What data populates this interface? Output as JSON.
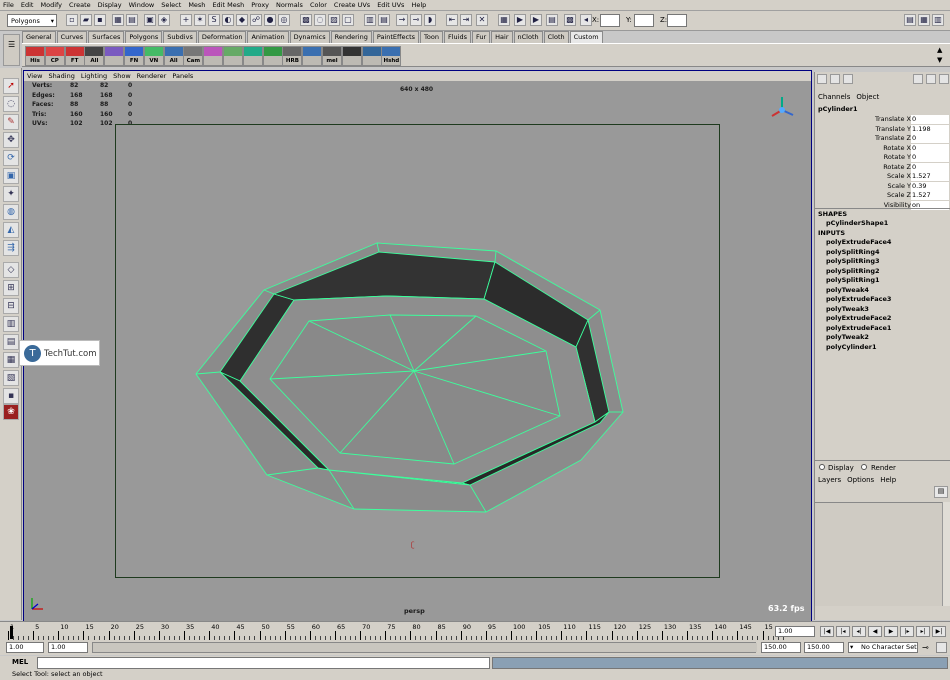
{
  "menubar": [
    "File",
    "Edit",
    "Modify",
    "Create",
    "Display",
    "Window",
    "Select",
    "Mesh",
    "Edit Mesh",
    "Proxy",
    "Normals",
    "Color",
    "Create UVs",
    "Edit UVs",
    "Help"
  ],
  "status": {
    "mode": "Polygons",
    "x_label": "X:",
    "y_label": "Y:",
    "z_label": "Z:"
  },
  "shelf_tabs": [
    "General",
    "Curves",
    "Surfaces",
    "Polygons",
    "Subdivs",
    "Deformation",
    "Animation",
    "Dynamics",
    "Rendering",
    "PaintEffects",
    "Toon",
    "Fluids",
    "Fur",
    "Hair",
    "nCloth",
    "Cloth",
    "Custom"
  ],
  "shelf_active": "Custom",
  "shelf_buttons": [
    "His",
    "CP",
    "FT",
    "All",
    "",
    "FN",
    "VN",
    "All",
    "Cam",
    "",
    "",
    "",
    "",
    "HRB",
    "",
    "mel",
    "",
    "",
    "Hshd"
  ],
  "panel_menu": [
    "View",
    "Shading",
    "Lighting",
    "Show",
    "Renderer",
    "Panels"
  ],
  "hud": {
    "rows": [
      {
        "label": "Verts:",
        "a": "82",
        "b": "82",
        "c": "0"
      },
      {
        "label": "Edges:",
        "a": "168",
        "b": "168",
        "c": "0"
      },
      {
        "label": "Faces:",
        "a": "88",
        "b": "88",
        "c": "0"
      },
      {
        "label": "Tris:",
        "a": "160",
        "b": "160",
        "c": "0"
      },
      {
        "label": "UVs:",
        "a": "102",
        "b": "102",
        "c": "0"
      }
    ],
    "resolution": "640 x 480",
    "camera": "persp",
    "fps": "63.2 fps"
  },
  "watermark": "TechTut.com",
  "channel_box": {
    "menu": [
      "Channels",
      "Object"
    ],
    "object": "pCylinder1",
    "attributes": [
      {
        "label": "Translate X",
        "value": "0"
      },
      {
        "label": "Translate Y",
        "value": "1.198"
      },
      {
        "label": "Translate Z",
        "value": "0"
      },
      {
        "label": "Rotate X",
        "value": "0"
      },
      {
        "label": "Rotate Y",
        "value": "0"
      },
      {
        "label": "Rotate Z",
        "value": "0"
      },
      {
        "label": "Scale X",
        "value": "1.527"
      },
      {
        "label": "Scale Y",
        "value": "0.39"
      },
      {
        "label": "Scale Z",
        "value": "1.527"
      },
      {
        "label": "Visibility",
        "value": "on"
      }
    ],
    "shapes_header": "SHAPES",
    "shape": "pCylinderShape1",
    "inputs_header": "INPUTS",
    "inputs": [
      "polyExtrudeFace4",
      "polySplitRing4",
      "polySplitRing3",
      "polySplitRing2",
      "polySplitRing1",
      "polyTweak4",
      "polyExtrudeFace3",
      "polyTweak3",
      "polyExtrudeFace2",
      "polyExtrudeFace1",
      "polyTweak2",
      "polyCylinder1"
    ]
  },
  "layers": {
    "display": "Display",
    "render": "Render",
    "menu": [
      "Layers",
      "Options",
      "Help"
    ]
  },
  "timeline": {
    "ticks": [
      "1",
      "5",
      "10",
      "15",
      "20",
      "25",
      "30",
      "35",
      "40",
      "45",
      "50",
      "55",
      "60",
      "65",
      "70",
      "75",
      "80",
      "85",
      "90",
      "95",
      "100",
      "105",
      "110",
      "115",
      "120",
      "125",
      "130",
      "135",
      "140",
      "145",
      "15"
    ],
    "current": "1.00"
  },
  "range": {
    "start": "1.00",
    "start2": "1.00",
    "end": "150.00",
    "end2": "150.00",
    "character_set": "No Character Set"
  },
  "cmd": {
    "label": "MEL"
  },
  "help_line": "Select Tool: select an object",
  "colors": {
    "viewport": "#999999",
    "wire": "#3cff9c",
    "face_dark": "#2e2e2e",
    "face_mid": "#8a8a8a",
    "panel": "#d4d0c8"
  }
}
